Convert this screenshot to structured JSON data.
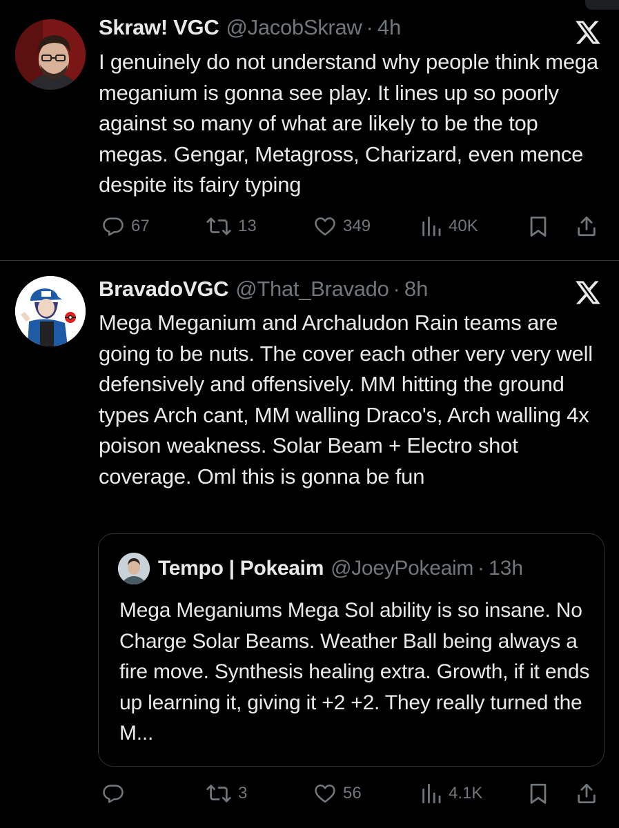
{
  "tweets": [
    {
      "display_name": "Skraw! VGC",
      "handle": "@JacobSkraw",
      "time": "4h",
      "separator": "·",
      "text": "I genuinely do not understand why people think mega meganium is gonna see play. It lines up so poorly against so many of what are likely to be the  top megas. Gengar, Metagross, Charizard, even mence despite its fairy typing",
      "replies": "67",
      "reposts": "13",
      "likes": "349",
      "views": "40K"
    },
    {
      "display_name": "BravadoVGC",
      "handle": "@That_Bravado",
      "time": "8h",
      "separator": "·",
      "text": "Mega Meganium and Archaludon Rain teams are going to be nuts. The cover each other very very well defensively and offensively. MM hitting the ground types Arch cant, MM walling Draco's, Arch walling 4x poison weakness. Solar Beam + Electro shot coverage. Oml this is gonna be fun",
      "replies": "",
      "reposts": "3",
      "likes": "56",
      "views": "4.1K",
      "quote": {
        "display_name": "Tempo | Pokeaim",
        "handle": "@JoeyPokeaim",
        "time": "13h",
        "separator": "·",
        "text": "Mega Meganiums Mega Sol ability is so insane. No Charge Solar Beams. Weather Ball being always a fire move. Synthesis healing extra. Growth, if it ends up learning it, giving it +2 +2. They really turned the M..."
      }
    }
  ],
  "colors": {
    "background": "#000000",
    "text_primary": "#e7e9ea",
    "text_secondary": "#71767b",
    "divider": "#2f3336"
  },
  "icons": [
    "reply-icon",
    "repost-icon",
    "like-icon",
    "views-icon",
    "bookmark-icon",
    "share-icon",
    "x-logo-icon"
  ]
}
